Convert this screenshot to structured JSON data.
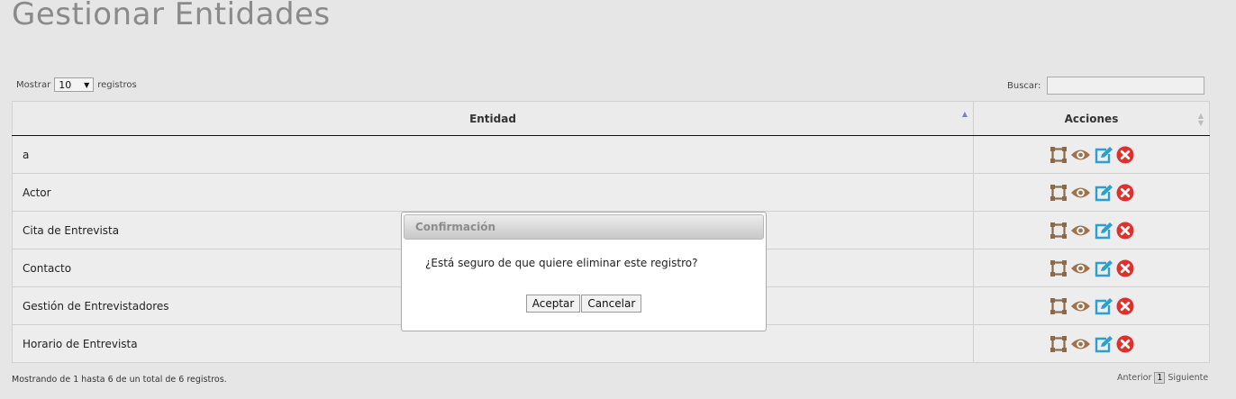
{
  "page": {
    "title": "Gestionar Entidades"
  },
  "length": {
    "prefix": "Mostrar",
    "value": "10",
    "suffix": "registros"
  },
  "search": {
    "label": "Buscar:",
    "value": ""
  },
  "table": {
    "headers": [
      "Entidad",
      "Acciones"
    ],
    "rows": [
      {
        "entidad": "a"
      },
      {
        "entidad": "Actor"
      },
      {
        "entidad": "Cita de Entrevista"
      },
      {
        "entidad": "Contacto"
      },
      {
        "entidad": "Gestión de Entrevistadores"
      },
      {
        "entidad": "Horario de Entrevista"
      }
    ],
    "action_icons": [
      "fields-icon",
      "view-icon",
      "edit-icon",
      "delete-icon"
    ]
  },
  "footer": {
    "info": "Mostrando de 1 hasta 6 de un total de 6 registros.",
    "prev": "Anterior",
    "page": "1",
    "next": "Siguiente"
  },
  "dialog": {
    "title": "Confirmación",
    "message": "¿Está seguro de que quiere eliminar este registro?",
    "accept": "Aceptar",
    "cancel": "Cancelar"
  },
  "colors": {
    "fields_icon": "#8a6a48",
    "view_icon": "#a0724c",
    "edit_icon": "#2b9fd0",
    "delete_icon": "#e0302c"
  }
}
